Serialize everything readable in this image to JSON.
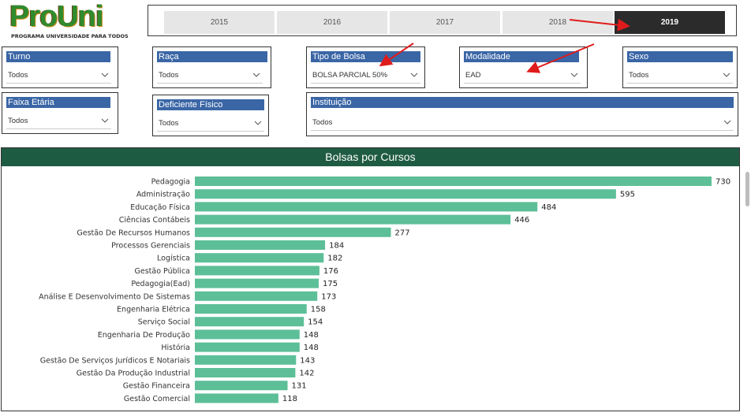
{
  "logo": {
    "title": "ProUni",
    "tagline": "PROGRAMA UNIVERSIDADE PARA TODOS"
  },
  "years": {
    "items": [
      "2015",
      "2016",
      "2017",
      "2018",
      "2019"
    ],
    "selected": "2019"
  },
  "filters": {
    "turno": {
      "label": "Turno",
      "value": "Todos"
    },
    "raca": {
      "label": "Raça",
      "value": "Todos"
    },
    "tipo_bolsa": {
      "label": "Tipo de Bolsa",
      "value": "BOLSA PARCIAL 50%"
    },
    "modalidade": {
      "label": "Modalidade",
      "value": "EAD"
    },
    "sexo": {
      "label": "Sexo",
      "value": "Todos"
    },
    "faixa_etaria": {
      "label": "Faixa Etária",
      "value": "Todos"
    },
    "deficiente": {
      "label": "Deficiente Físico",
      "value": "Todos"
    },
    "instituicao": {
      "label": "Instituição",
      "value": "Todos"
    }
  },
  "colors": {
    "bar": "#5dbf97",
    "header": "#3a66a6",
    "chart_title_bg": "#1e5b43",
    "arrow": "#e01b1b"
  },
  "chart_data": {
    "type": "bar",
    "orientation": "horizontal",
    "title": "Bolsas por Cursos",
    "categories": [
      "Pedagogia",
      "Administração",
      "Educação Física",
      "Ciências Contábeis",
      "Gestão De Recursos Humanos",
      "Processos Gerenciais",
      "Logística",
      "Gestão Pública",
      "Pedagogia(Ead)",
      "Análise E Desenvolvimento De Sistemas",
      "Engenharia Elétrica",
      "Serviço Social",
      "Engenharia De Produção",
      "História",
      "Gestão De Serviços Jurídicos E Notariais",
      "Gestão Da Produção Industrial",
      "Gestão Financeira",
      "Gestão Comercial"
    ],
    "values": [
      730,
      595,
      484,
      446,
      277,
      184,
      182,
      176,
      175,
      173,
      158,
      154,
      148,
      148,
      143,
      142,
      131,
      118
    ],
    "data_labels": true,
    "grid": false
  }
}
